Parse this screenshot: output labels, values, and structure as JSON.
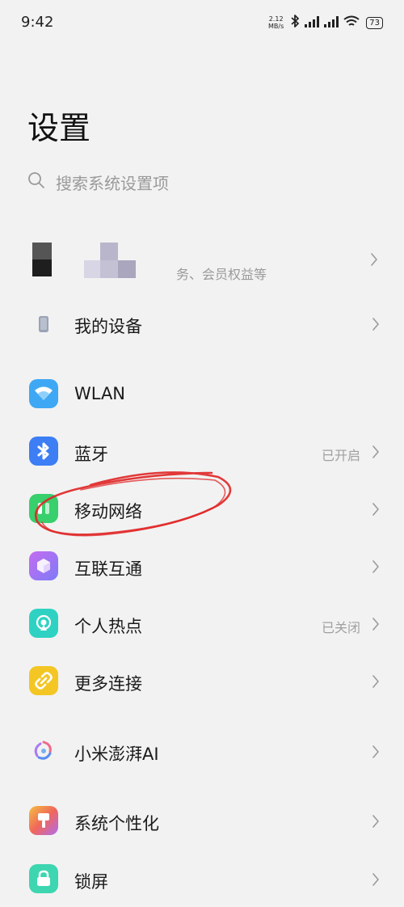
{
  "status_bar": {
    "time": "9:42",
    "speed_value": "2.12",
    "speed_unit": "MB/s",
    "battery": "73"
  },
  "title": "设置",
  "search": {
    "placeholder": "搜索系统设置项"
  },
  "account": {
    "subtitle": "务、会员权益等"
  },
  "items": [
    {
      "label": "我的设备",
      "value": "",
      "icon": "phone-icon",
      "color": "#9aa3b5"
    },
    {
      "label": "WLAN",
      "value": "",
      "icon": "wifi-icon",
      "color": "#3fa8f4"
    },
    {
      "label": "蓝牙",
      "value": "已开启",
      "icon": "bluetooth-icon",
      "color": "#3d7ef5"
    },
    {
      "label": "移动网络",
      "value": "",
      "icon": "mobile-network-icon",
      "color": "#38cf6d"
    },
    {
      "label": "互联互通",
      "value": "",
      "icon": "interconnect-icon",
      "color": "#9b6cf5"
    },
    {
      "label": "个人热点",
      "value": "已关闭",
      "icon": "hotspot-icon",
      "color": "#2fd2c2"
    },
    {
      "label": "更多连接",
      "value": "",
      "icon": "more-connections-icon",
      "color": "#f3c624"
    },
    {
      "label": "小米澎湃AI",
      "value": "",
      "icon": "ai-icon",
      "color": "#5aa0f0"
    },
    {
      "label": "系统个性化",
      "value": "",
      "icon": "personalization-icon",
      "color": "#f2784a"
    },
    {
      "label": "锁屏",
      "value": "",
      "icon": "lock-screen-icon",
      "color": "#3dd6b0"
    }
  ],
  "annotation": {
    "type": "red-circle",
    "target": "移动网络",
    "color": "#e02424"
  }
}
